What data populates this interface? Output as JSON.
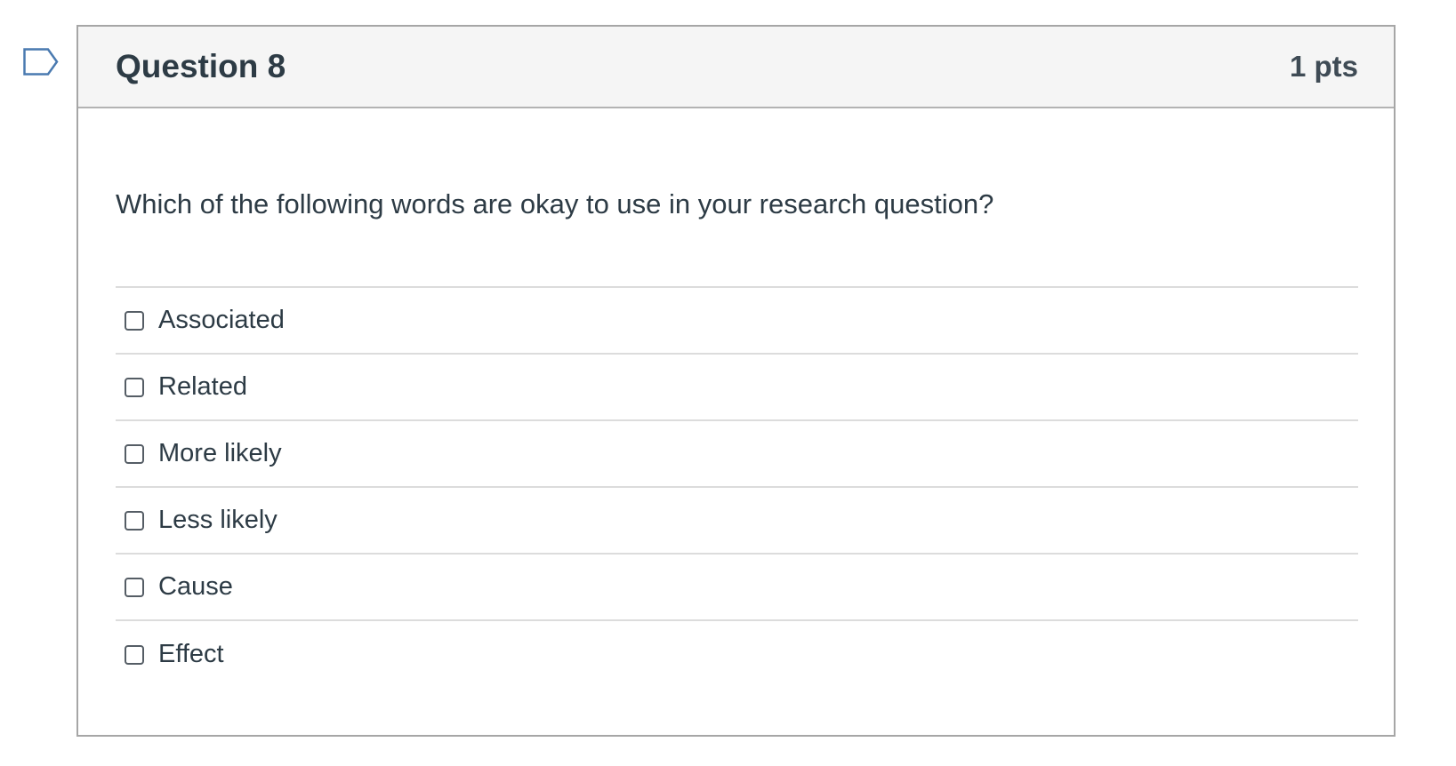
{
  "flag": {
    "icon": "flag-icon"
  },
  "question": {
    "title": "Question 8",
    "points": "1 pts",
    "text": "Which of the following words are okay to use in your research question?",
    "answers": [
      {
        "label": "Associated",
        "checked": false
      },
      {
        "label": "Related",
        "checked": false
      },
      {
        "label": "More likely",
        "checked": false
      },
      {
        "label": "Less likely",
        "checked": false
      },
      {
        "label": "Cause",
        "checked": false
      },
      {
        "label": "Effect",
        "checked": false
      }
    ]
  },
  "colors": {
    "text": "#2d3b45",
    "header_bg": "#f5f5f5",
    "border": "#a6a6a6",
    "flag_stroke": "#4a7ab0"
  }
}
